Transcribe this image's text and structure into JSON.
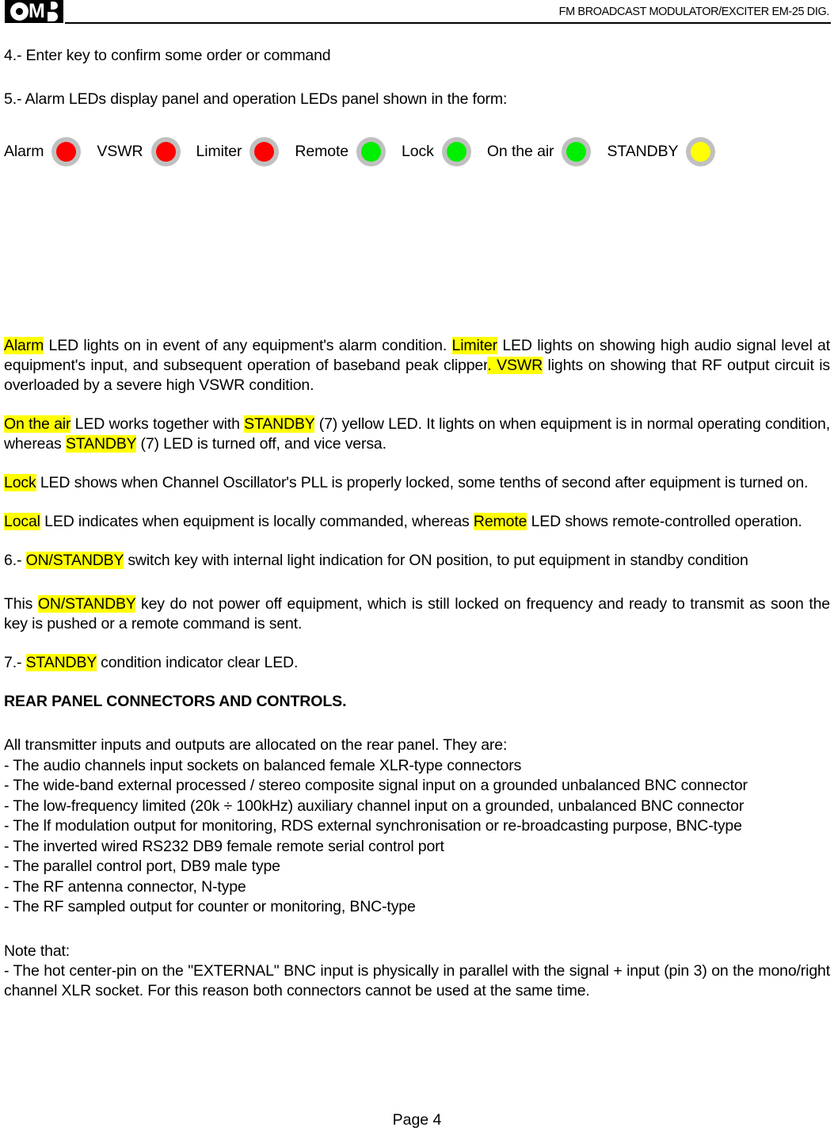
{
  "header": {
    "logo_text": "OMB",
    "title": "FM BROADCAST MODULATOR/EXCITER EM-25 DIG."
  },
  "items": {
    "item4": "4.- Enter key to confirm some order or command",
    "item5": "5.- Alarm LEDs display panel and operation LEDs panel shown in the form:"
  },
  "led_panel": {
    "leds": [
      {
        "label": "Alarm",
        "color": "#ff0000",
        "color_name": "red"
      },
      {
        "label": "VSWR",
        "color": "#ff0000",
        "color_name": "red"
      },
      {
        "label": "Limiter",
        "color": "#ff0000",
        "color_name": "red"
      },
      {
        "label": "Remote",
        "color": "#00ee00",
        "color_name": "green"
      },
      {
        "label": "Lock",
        "color": "#00ee00",
        "color_name": "green"
      },
      {
        "label": "On the air",
        "color": "#00ee00",
        "color_name": "green"
      },
      {
        "label": "STANDBY",
        "color": "#ffff00",
        "color_name": "yellow"
      }
    ],
    "ring_color": "#c0c0c0"
  },
  "paragraphs": {
    "alarm": {
      "hl1": "Alarm",
      "t1": " LED lights on in event of any equipment's alarm condition. ",
      "hl2": "Limiter",
      "t2": " LED lights on showing high audio signal level at equipment's  input, and subsequent operation of baseband peak clipper",
      "hl3": ". VSWR",
      "t3": " lights on showing that RF output circuit is overloaded by a severe  high VSWR condition."
    },
    "ontheair": {
      "hl1": "On the air",
      "t1": "  LED works together with ",
      "hl2": "STANDBY",
      "t2": " (7) yellow LED. It lights on when equipment is in normal operating condition, whereas ",
      "hl3": "STANDBY",
      "t3": " (7) LED is turned off, and vice versa."
    },
    "lock": {
      "hl1": "Lock",
      "t1": " LED shows when Channel Oscillator's PLL is properly locked, some tenths of second after equipment is turned on."
    },
    "local": {
      "hl1": "Local",
      "t1": " LED indicates when equipment is locally commanded, whereas ",
      "hl2": "Remote",
      "t2": " LED shows remote-controlled operation."
    },
    "item6": {
      "pre": "6.- ",
      "hl1": "ON/STANDBY",
      "t1": " switch key with internal light indication for ON position, to put equipment in standby condition"
    },
    "item6b": {
      "pre": "This ",
      "hl1": "ON/STANDBY",
      "t1": " key do not power off equipment, which is still locked on frequency and ready to transmit as soon the key is pushed or a remote command is sent."
    },
    "item7": {
      "pre": "7.- ",
      "hl1": "STANDBY",
      "t1": " condition indicator clear LED."
    }
  },
  "rear_panel": {
    "heading": "REAR PANEL CONNECTORS AND CONTROLS.",
    "intro": "All transmitter inputs and outputs are allocated on the rear panel. They are:",
    "bullets": [
      "- The audio channels input sockets on balanced female XLR-type connectors",
      "- The wide-band external processed / stereo composite signal input on a grounded unbalanced BNC connector",
      "- The low-frequency limited (20k ÷ 100kHz) auxiliary channel input on a grounded, unbalanced BNC connector",
      "- The lf modulation output for monitoring, RDS external synchronisation or re-broadcasting purpose, BNC-type",
      "- The inverted wired RS232 DB9 female remote serial control port",
      "- The parallel control port, DB9 male type",
      "- The RF antenna connector, N-type",
      "- The RF sampled output for counter or monitoring, BNC-type"
    ],
    "note_label": "Note that:",
    "note_text": "- The hot center-pin on the \"EXTERNAL\" BNC input is physically in parallel with the signal + input (pin 3) on the mono/right channel XLR socket. For this reason both connectors cannot be used at the same time."
  },
  "footer": {
    "page_number": "Page 4"
  }
}
